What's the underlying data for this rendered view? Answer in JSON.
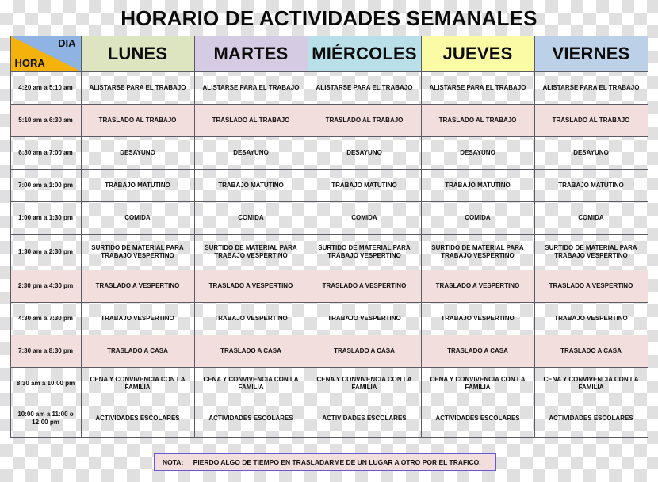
{
  "document": {
    "title": "HORARIO DE ACTIVIDADES SEMANALES"
  },
  "table": {
    "corner": {
      "day_label": "DIA",
      "hour_label": "HORA",
      "day_bg": "#8fb4e3",
      "hour_bg": "#f5b20b"
    },
    "day_columns": [
      {
        "label": "LUNES",
        "bg": "#dde5c0"
      },
      {
        "label": "MARTES",
        "bg": "#d5cce4"
      },
      {
        "label": "MIÉRCOLES",
        "bg": "#b9dfe8"
      },
      {
        "label": "JUEVES",
        "bg": "#fbfba6"
      },
      {
        "label": "VIERNES",
        "bg": "#bcd0e8"
      }
    ],
    "row_colors": {
      "white": "#ffffff",
      "pink": "#f2dedd"
    },
    "rows": [
      {
        "time": "4:20 am  a  5:10 am",
        "activity": "ALISTARSE PARA EL TRABAJO",
        "shade": "white"
      },
      {
        "time": "5:10 am  a  6:30 am",
        "activity": "TRASLADO AL TRABAJO",
        "shade": "pink"
      },
      {
        "time": "6:30 am  a  7:00 am",
        "activity": "DESAYUNO",
        "shade": "white"
      },
      {
        "time": "7:00 am  a  1:00 pm",
        "activity": "TRABAJO MATUTINO",
        "shade": "white"
      },
      {
        "time": "1:00 am  a  1:30 pm",
        "activity": "COMIDA",
        "shade": "white"
      },
      {
        "time": "1:30 am a 2:30 pm",
        "activity": "SURTIDO DE MATERIAL PARA TRABAJO VESPERTINO",
        "shade": "white"
      },
      {
        "time": "2:30 pm a 4:30 pm",
        "activity": "TRASLADO A VESPERTINO",
        "shade": "pink"
      },
      {
        "time": "4:30 am a 7:30 pm",
        "activity": "TRABAJO VESPERTINO",
        "shade": "white"
      },
      {
        "time": "7:30 am a 8:30 pm",
        "activity": "TRASLADO A CASA",
        "shade": "pink"
      },
      {
        "time": "8:30 am a 10:00 pm",
        "activity": "CENA Y CONVIVENCIA CON LA FAMILIA",
        "shade": "white"
      },
      {
        "time": "10:00 am a 11:00 o 12:00 pm",
        "activity": "ACTIVIDADES ESCOLARES",
        "shade": "white"
      }
    ]
  },
  "note": {
    "label": "NOTA:",
    "text": "PIERDO ALGO DE TIEMPO EN TRASLADARME DE UN LUGAR A OTRO POR EL TRAFICO.",
    "border_color": "#6a58d8",
    "bg": "#f2dedd"
  }
}
